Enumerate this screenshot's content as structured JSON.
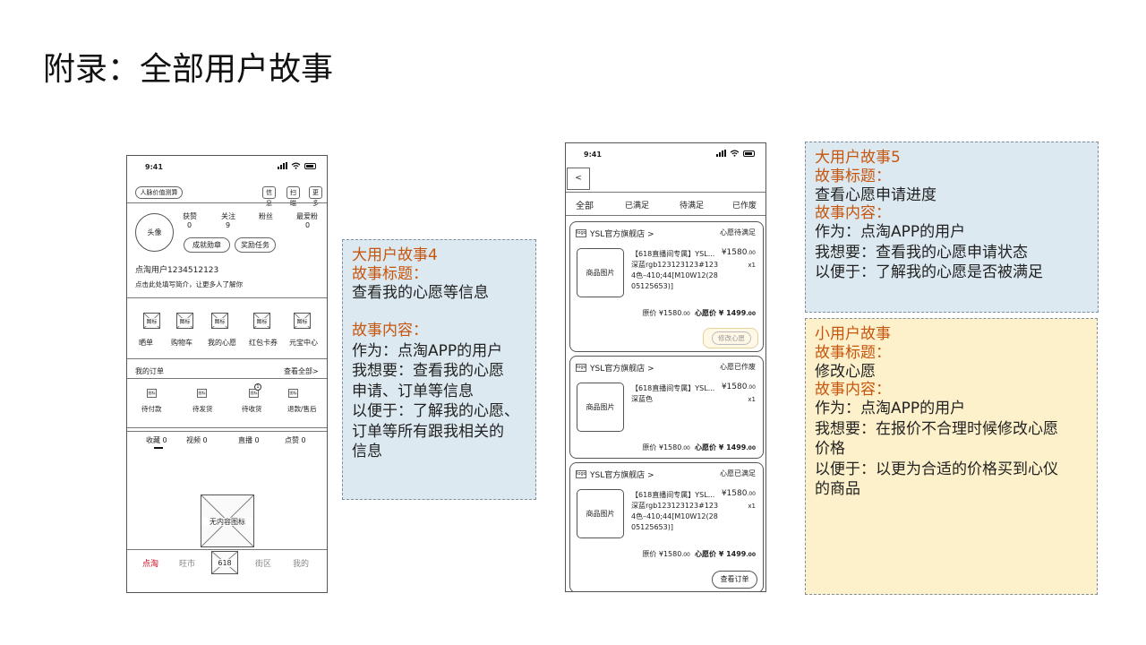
{
  "slide": {
    "title": "附录：全部用户故事"
  },
  "phone1": {
    "time": "9:41",
    "top_btn": "人脉价值测算",
    "top_icons": [
      "信息",
      "扫瞄",
      "更多"
    ],
    "avatar": "头像",
    "stats": [
      {
        "label": "获赞",
        "value": "0"
      },
      {
        "label": "关注",
        "value": "9"
      },
      {
        "label": "粉丝",
        "value": ""
      },
      {
        "label": "最爱粉",
        "value": "0"
      }
    ],
    "badge_btn": "成就勋章",
    "reward_btn": "奖励任务",
    "username": "点淘用户1234512123",
    "intro": "点击此处填写简介，让更多人了解你",
    "icon_placeholder": "图标",
    "grid": [
      "晒单",
      "购物车",
      "我的心愿",
      "红包卡券",
      "元宝中心"
    ],
    "orders_title": "我的订单",
    "orders_all": "查看全部>",
    "order_icon": "图标",
    "orders": [
      "待付款",
      "待发货",
      "待收货",
      "退款/售后"
    ],
    "badge_count": "1",
    "content_tabs": [
      "收藏 0",
      "视频 0",
      "直播 0",
      "点赞 0"
    ],
    "empty": "无内容图标",
    "bottom_tabs": [
      "点淘",
      "旺市",
      "618",
      "街区",
      "我的"
    ]
  },
  "phone2": {
    "time": "9:41",
    "back": "<",
    "tabs": [
      "全部",
      "已满足",
      "待满足",
      "已作废"
    ],
    "logo": "logo",
    "product_img": "商品图片",
    "cards": [
      {
        "shop": "YSL官方旗舰店 >",
        "status": "心愿待满足",
        "name": "【618直播间专属】YSL...",
        "spec": "深蓝rgb123123123#1234色–410;44[M10W12(2805125653)]",
        "price": "¥1580",
        "price_dec": ".00",
        "qty": "x1",
        "orig": "原价 ¥1580",
        "orig_dec": ".00",
        "wish": "心愿价 ¥ 1499",
        "wish_dec": ".00",
        "action": "修改心愿"
      },
      {
        "shop": "YSL官方旗舰店 >",
        "status": "心愿已作废",
        "name": "【618直播间专属】YSL...",
        "spec": "深蓝色",
        "price": "¥1580",
        "price_dec": ".00",
        "qty": "x1",
        "orig": "原价 ¥1580",
        "orig_dec": ".00",
        "wish": "心愿价 ¥ 1499",
        "wish_dec": ".00"
      },
      {
        "shop": "YSL官方旗舰店 >",
        "status": "心愿已满足",
        "name": "【618直播间专属】YSL...",
        "spec": "深蓝rgb123123123#1234色–410;44[M10W12(2805125653)]",
        "price": "¥1580",
        "price_dec": ".00",
        "qty": "x1",
        "orig": "原价 ¥1580",
        "orig_dec": ".00",
        "wish": "心愿价 ¥ 1499",
        "wish_dec": ".00",
        "action": "查看订单"
      }
    ]
  },
  "story4": {
    "heading": "大用户故事4",
    "title_label": "故事标题：",
    "title": "查看我的心愿等信息",
    "content_label": "故事内容：",
    "lines": [
      "作为：点淘APP的用户",
      "我想要：查看我的心愿",
      "申请、订单等信息",
      "以便于：了解我的心愿、",
      "订单等所有跟我相关的",
      "信息"
    ]
  },
  "story5": {
    "heading": "大用户故事5",
    "title_label": "故事标题：",
    "title": "查看心愿申请进度",
    "content_label": "故事内容：",
    "lines": [
      "作为：点淘APP的用户",
      "我想要：查看我的心愿申请状态",
      "以便于：了解我的心愿是否被满足"
    ]
  },
  "small_story": {
    "heading": "小用户故事",
    "title_label": "故事标题：",
    "title": "修改心愿",
    "content_label": "故事内容：",
    "lines": [
      "作为：点淘APP的用户",
      "我想要：在报价不合理时候修改心愿",
      "价格",
      "以便于：以更为合适的价格买到心仪",
      "的商品"
    ]
  },
  "colors": {
    "accent": "#c6550d",
    "active_tab": "#d0021b",
    "blue_box": "#dde9f0",
    "yellow_box": "#fdf1cc"
  }
}
